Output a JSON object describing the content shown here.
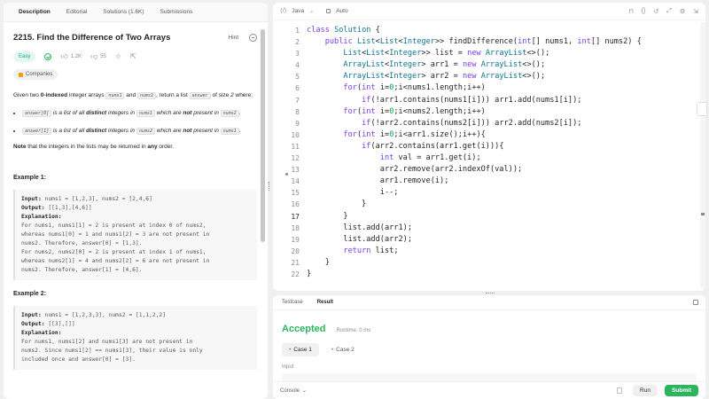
{
  "left_tabs": [
    "Description",
    "Editorial",
    "Solutions (1.6K)",
    "Submissions"
  ],
  "problem": {
    "title": "2215. Find the Difference of Two Arrays",
    "hint": "Hint",
    "difficulty": "Easy",
    "likes": "1.2K",
    "dislikes": "55",
    "companies": "Companies",
    "intro_pre": "Given two ",
    "intro_bold": "0-indexed",
    "intro_mid": " integer arrays ",
    "nums1": "nums1",
    "and": " and ",
    "nums2": "nums2",
    "intro_post": ", return a list ",
    "answer": "answer",
    "of_size": " of size ",
    "two": "2",
    "where": " where:",
    "bullet1_code": "answer[0]",
    "bullet1_pre": " is a list of all ",
    "bullet1_bold": "distinct",
    "bullet1_mid": " integers in ",
    "bullet1_c1": "nums1",
    "bullet1_post": " which are ",
    "bullet1_not": "not",
    "bullet1_end": " present in ",
    "bullet1_c2": "nums2",
    "bullet2_code": "answer[1]",
    "bullet2_pre": " is a list of all ",
    "bullet2_bold": "distinct",
    "bullet2_mid": " integers in ",
    "bullet2_c1": "nums2",
    "bullet2_post": " which are ",
    "bullet2_not": "not",
    "bullet2_end": " present in ",
    "bullet2_c2": "nums1",
    "note_bold": "Note",
    "note_text": " that the integers in the lists may be returned in ",
    "note_any": "any",
    "note_end": " order.",
    "example1_title": "Example 1:",
    "example1": {
      "input_label": "Input:",
      "input": " nums1 = [1,2,3], nums2 = [2,4,6]",
      "output_label": "Output:",
      "output": " [[1,3],[4,6]]",
      "expl_label": "Explanation:",
      "expl": "For nums1, nums1[1] = 2 is present at index 0 of nums2,\nwhereas nums1[0] = 1 and nums1[2] = 3 are not present in\nnums2. Therefore, answer[0] = [1,3].\nFor nums2, nums2[0] = 2 is present at index 1 of nums1,\nwhereas nums2[1] = 4 and nums2[2] = 6 are not present in\nnums2. Therefore, answer[1] = [4,6]."
    },
    "example2_title": "Example 2:",
    "example2": {
      "input_label": "Input:",
      "input": " nums1 = [1,2,3,3], nums2 = [1,1,2,2]",
      "output_label": "Output:",
      "output": " [[3],[]]",
      "expl_label": "Explanation:",
      "expl": "For nums1, nums1[2] and nums1[3] are not present in\nnums2. Since nums1[2] == nums1[3], their value is only\nincluded once and answer[0] = [3]."
    }
  },
  "editor": {
    "language": "Java",
    "mode": "Auto",
    "line_numbers": [
      "1",
      "2",
      "3",
      "4",
      "5",
      "6",
      "7",
      "8",
      "9",
      "10",
      "11",
      "12",
      "13",
      "14",
      "15",
      "16",
      "17",
      "18",
      "19",
      "20",
      "21",
      "22"
    ],
    "current_line": "17"
  },
  "result_panel": {
    "tabs": [
      "Testcase",
      "Result"
    ],
    "status": "Accepted",
    "runtime": "Runtime: 0 ms",
    "cases": [
      "Case 1",
      "Case 2"
    ],
    "input_label": "Input",
    "console": "Console",
    "run": "Run",
    "submit": "Submit"
  },
  "colors": {
    "accepted": "#2db55d",
    "submit": "#2db55d",
    "keyword": "#7c3aed",
    "type": "#1e40af"
  }
}
